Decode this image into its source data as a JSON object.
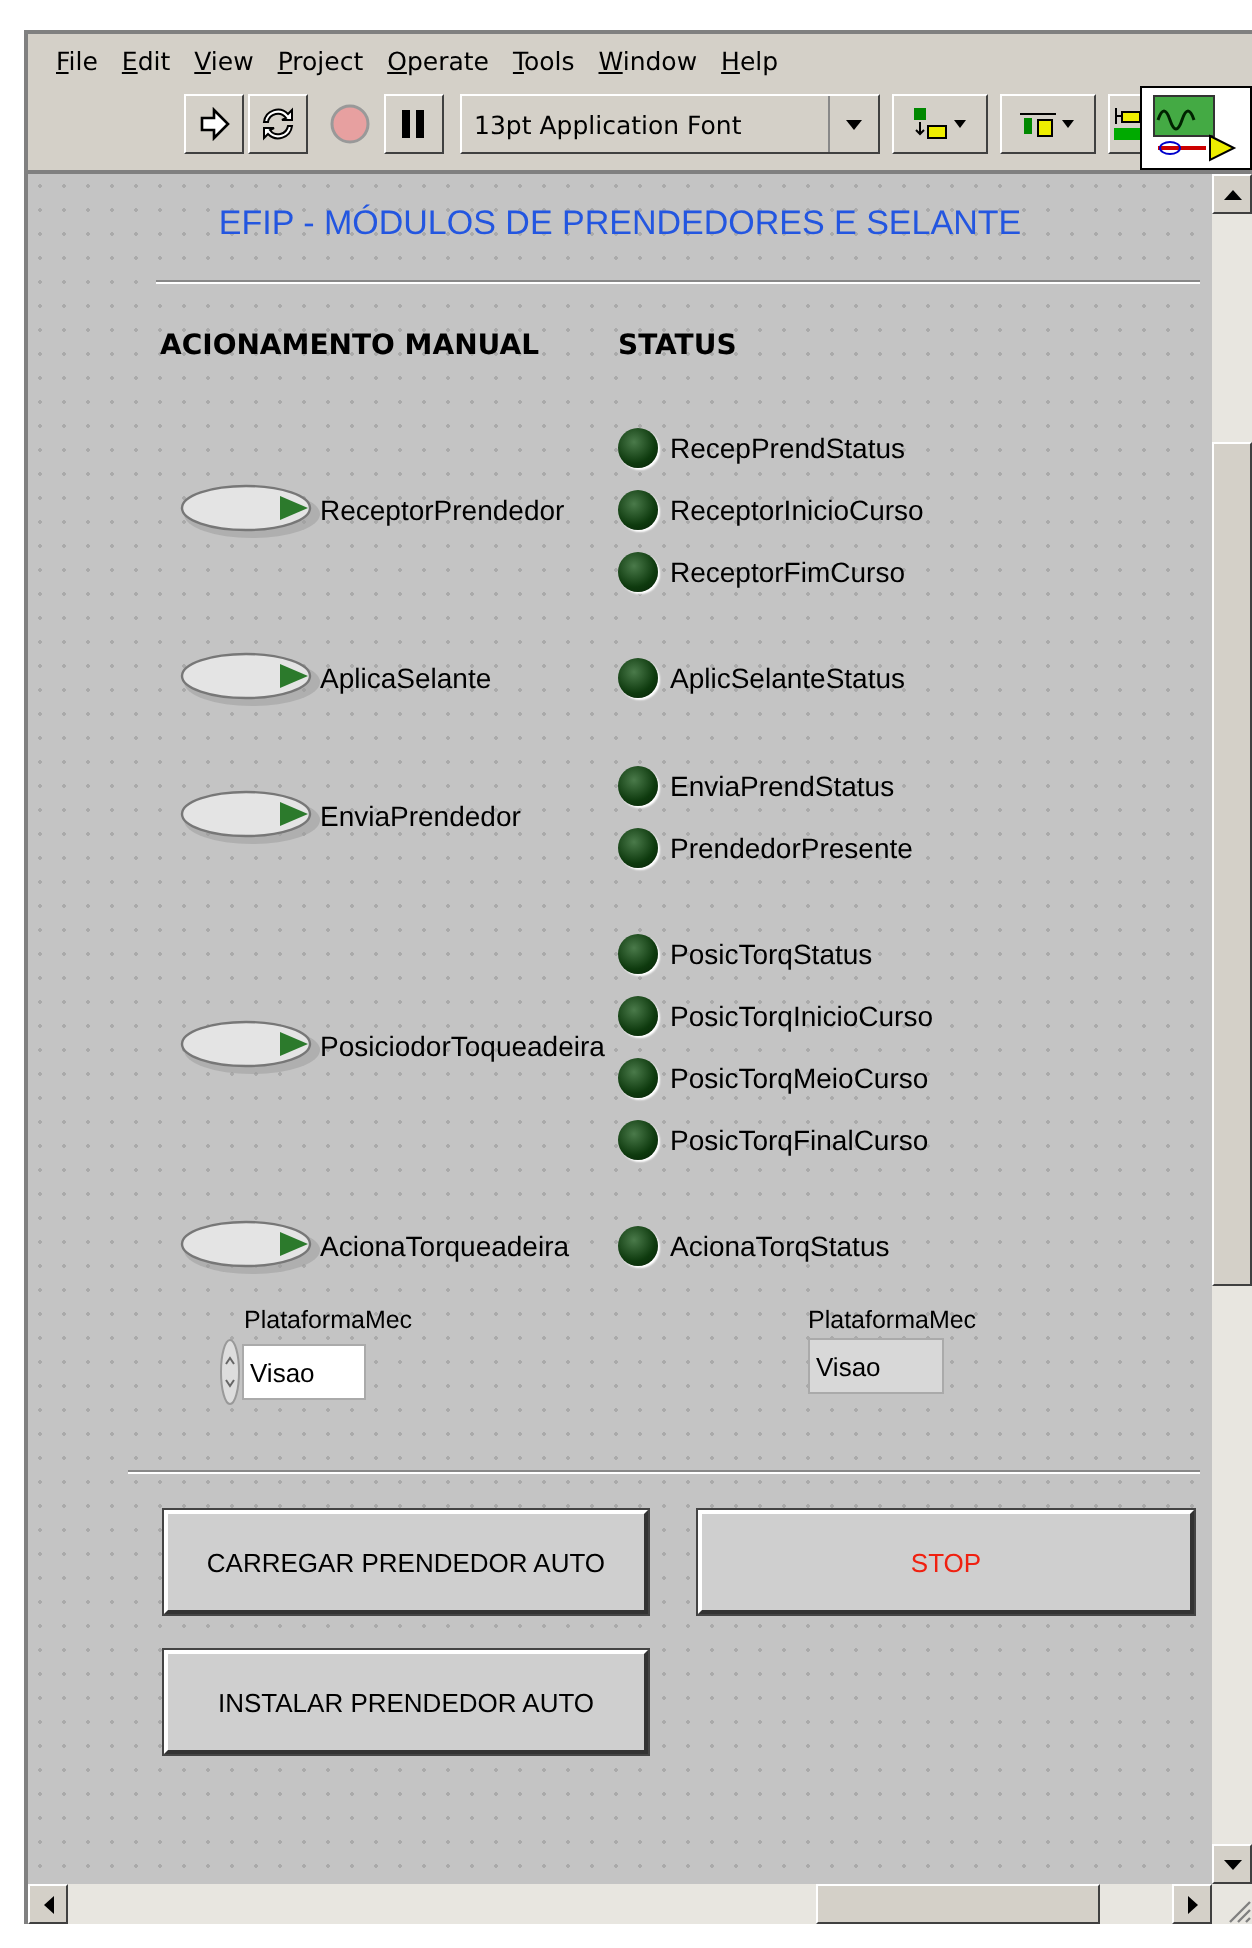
{
  "menu": [
    "File",
    "Edit",
    "View",
    "Project",
    "Operate",
    "Tools",
    "Window",
    "Help"
  ],
  "toolbar": {
    "font_dropdown": "13pt Application Font"
  },
  "panel": {
    "title": "EFIP - MÓDULOS DE PRENDEDORES E SELANTE",
    "headers": [
      "ACIONAMENTO MANUAL",
      "STATUS"
    ],
    "groups": [
      {
        "button": "ReceptorPrendedor",
        "leds": [
          {
            "label": "RecepPrendStatus",
            "on": false
          },
          {
            "label": "ReceptorInicioCurso",
            "on": false
          },
          {
            "label": "ReceptorFimCurso",
            "on": false
          }
        ]
      },
      {
        "button": "AplicaSelante",
        "leds": [
          {
            "label": "AplicSelanteStatus",
            "on": false
          }
        ]
      },
      {
        "button": "EnviaPrendedor",
        "leds": [
          {
            "label": "EnviaPrendStatus",
            "on": false
          },
          {
            "label": "PrendedorPresente",
            "on": false
          }
        ]
      },
      {
        "button": "PosiciodorToqueadeira",
        "leds": [
          {
            "label": "PosicTorqStatus",
            "on": false
          },
          {
            "label": "PosicTorqInicioCurso",
            "on": false
          },
          {
            "label": "PosicTorqMeioCurso",
            "on": false
          },
          {
            "label": "PosicTorqFinalCurso",
            "on": false
          }
        ]
      },
      {
        "button": "AcionaTorqueadeira",
        "leds": [
          {
            "label": "AcionaTorqStatus",
            "on": false
          }
        ]
      }
    ],
    "enums": [
      {
        "kind": "control",
        "label": "PlataformaMec",
        "value": "Visao"
      },
      {
        "kind": "indicator",
        "label": "PlataformaMec",
        "value": "Visao"
      }
    ],
    "buttons": [
      {
        "kind": "normal",
        "label": "CARREGAR PRENDEDOR AUTO"
      },
      {
        "kind": "stop",
        "label": "STOP"
      },
      {
        "kind": "normal",
        "label": "INSTALAR PRENDEDOR AUTO"
      }
    ]
  }
}
